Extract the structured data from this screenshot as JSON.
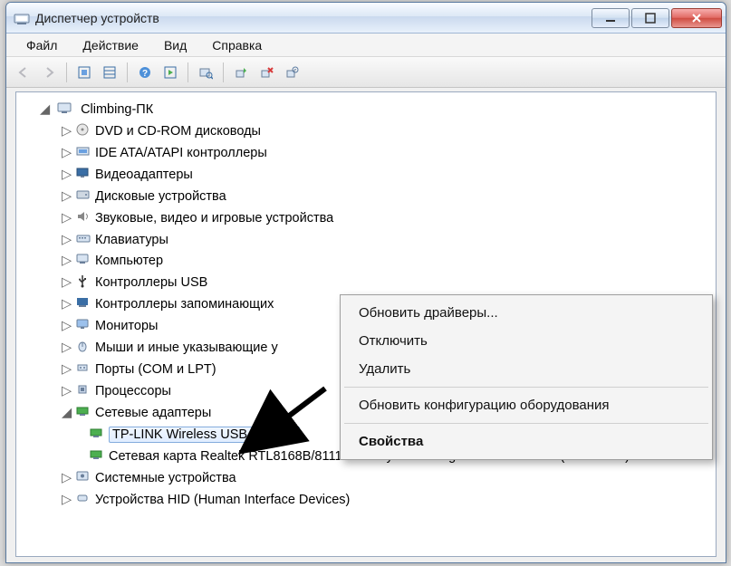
{
  "title": "Диспетчер устройств",
  "menu": {
    "file": "Файл",
    "action": "Действие",
    "view": "Вид",
    "help": "Справка"
  },
  "root": "Climbing-ПК",
  "nodes": {
    "dvd": "DVD и CD-ROM дисководы",
    "ata": "IDE ATA/ATAPI контроллеры",
    "video": "Видеоадаптеры",
    "disk": "Дисковые устройства",
    "audio": "Звуковые, видео и игровые устройства",
    "keyboard": "Клавиатуры",
    "computer": "Компьютер",
    "usb": "Контроллеры USB",
    "storage": "Контроллеры запоминающих",
    "monitor": "Мониторы",
    "mouse": "Мыши и иные указывающие у",
    "ports": "Порты (COM и LPT)",
    "cpu": "Процессоры",
    "network": "Сетевые адаптеры",
    "tplink": "TP-LINK Wireless USB Adapter",
    "realtek": "Сетевая карта Realtek RTL8168B/8111B Family PCI-E Gigabit Ethernet NIC (NDIS 6.20)",
    "system": "Системные устройства",
    "hid": "Устройства HID (Human Interface Devices)"
  },
  "context": {
    "update": "Обновить драйверы...",
    "disable": "Отключить",
    "uninstall": "Удалить",
    "rescan": "Обновить конфигурацию оборудования",
    "properties": "Свойства"
  }
}
